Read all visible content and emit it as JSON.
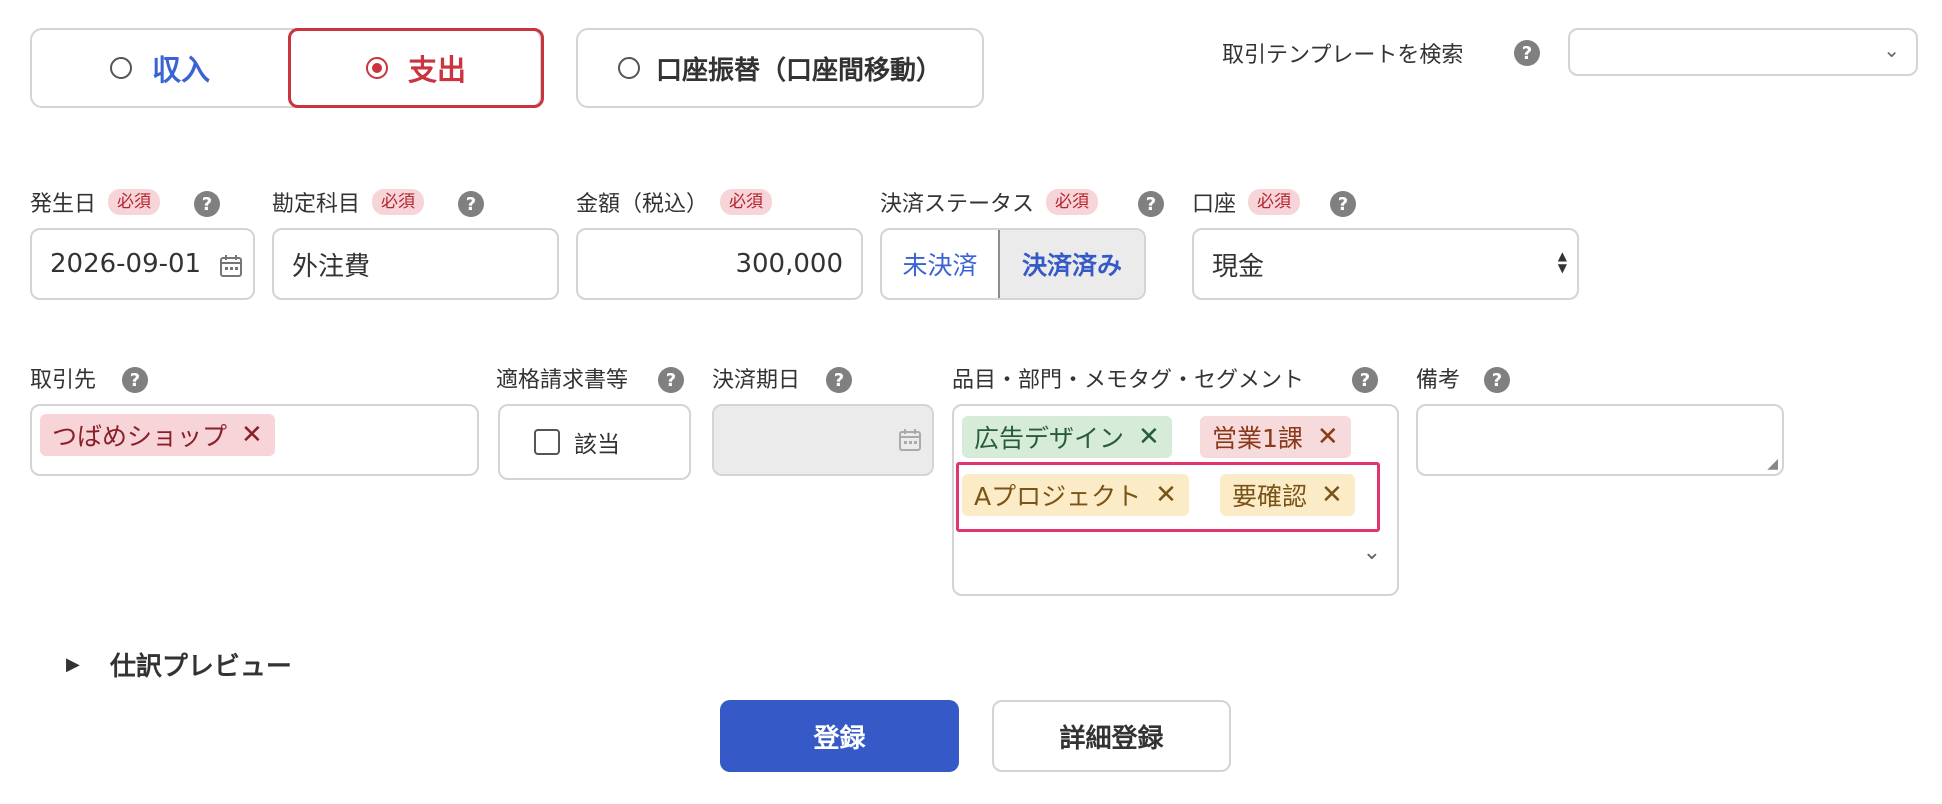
{
  "type_tabs": {
    "income": "収入",
    "expense": "支出",
    "transfer": "口座振替（口座間移動）"
  },
  "template_search": {
    "label": "取引テンプレートを検索",
    "value": ""
  },
  "fields": {
    "date": {
      "label": "発生日",
      "required": "必須",
      "value": "2026-09-01"
    },
    "account_item": {
      "label": "勘定科目",
      "required": "必須",
      "value": "外注費"
    },
    "amount": {
      "label": "金額（税込）",
      "required": "必須",
      "value": "300,000"
    },
    "settlement": {
      "label": "決済ステータス",
      "required": "必須",
      "unsettled": "未決済",
      "settled": "決済済み"
    },
    "wallet": {
      "label": "口座",
      "required": "必須",
      "value": "現金"
    },
    "partner": {
      "label": "取引先",
      "chip": "つばめショップ"
    },
    "invoice": {
      "label": "適格請求書等",
      "checkbox_label": "該当"
    },
    "due_date": {
      "label": "決済期日",
      "value": ""
    },
    "tags": {
      "label": "品目・部門・メモタグ・セグメント",
      "chips": [
        "広告デザイン",
        "営業1課",
        "Aプロジェクト",
        "要確認"
      ]
    },
    "notes": {
      "label": "備考",
      "value": ""
    }
  },
  "journal_preview": "仕訳プレビュー",
  "buttons": {
    "register": "登録",
    "detail_register": "詳細登録"
  },
  "icons": {
    "help": "question-circle-icon",
    "calendar": "calendar-icon",
    "chevron": "chevron-down-icon",
    "remove": "close-icon",
    "caret": "caret-right-icon"
  },
  "colors": {
    "income_blue": "#3a63d6",
    "expense_red": "#c9343e",
    "primary_button": "#3559c6",
    "highlight_pink": "#e0356f",
    "chip_green": "#d6ecd9",
    "chip_red": "#f7dadc",
    "chip_yellow": "#fbebc7"
  }
}
